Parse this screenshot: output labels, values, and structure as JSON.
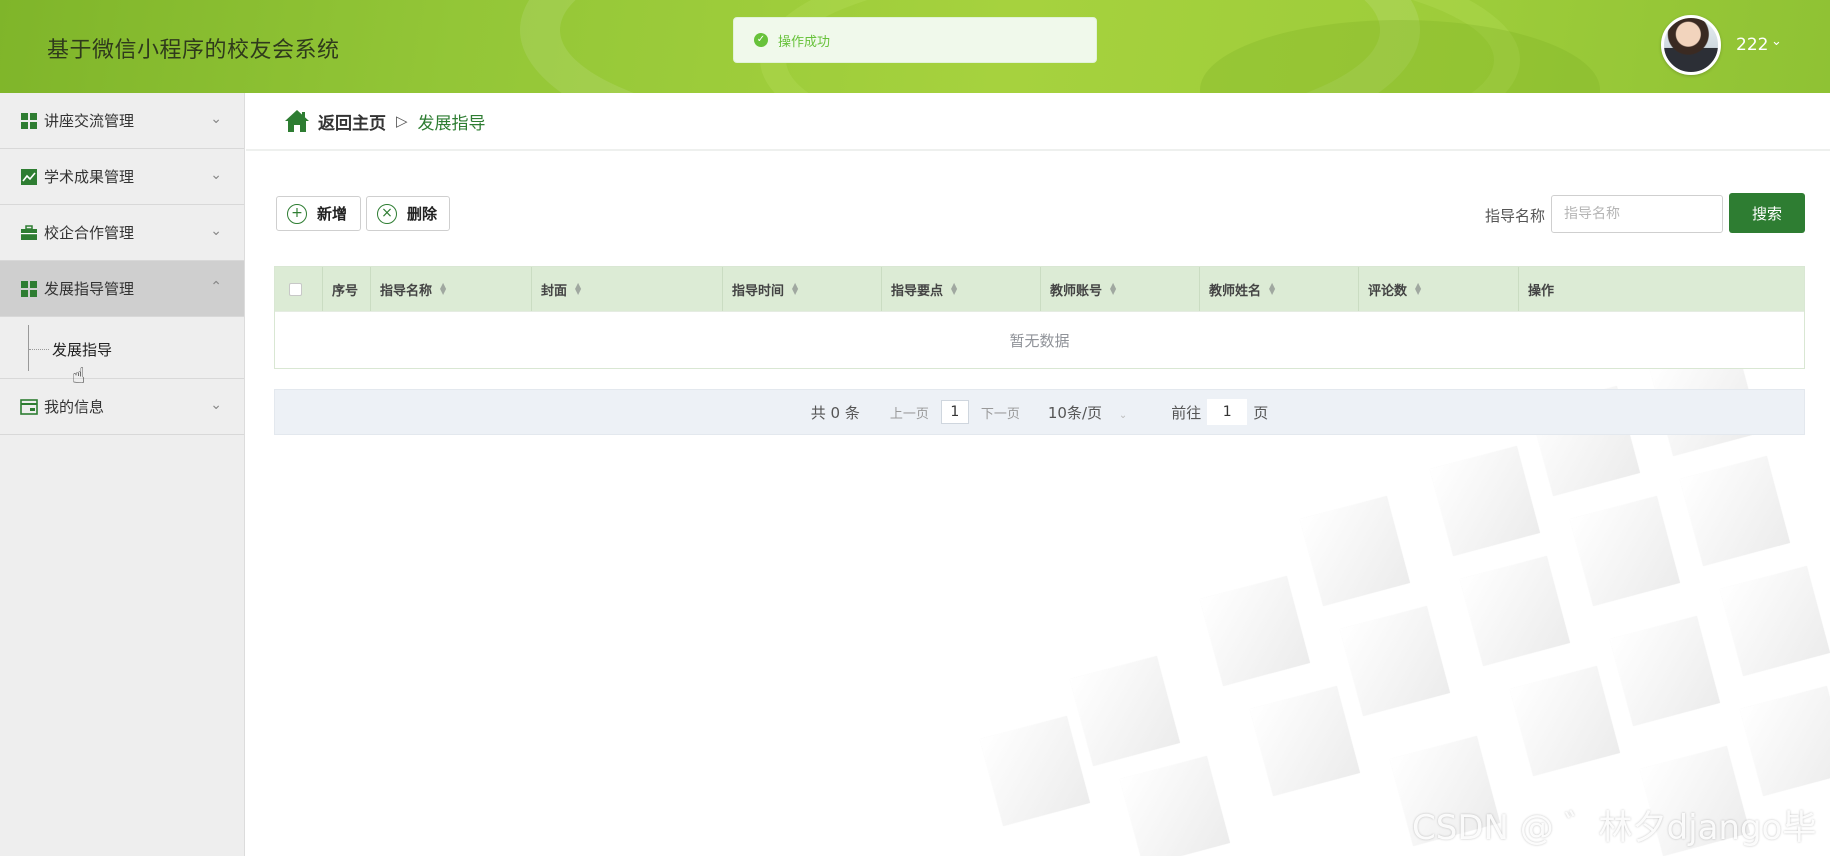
{
  "header": {
    "app_title": "基于微信小程序的校友会系统",
    "toast_text": "操作成功",
    "user_name": "222",
    "user_caret_icon": "chevron-down-icon"
  },
  "sidebar": {
    "items": [
      {
        "label": "讲座交流管理",
        "icon": "grid-icon",
        "expanded": false
      },
      {
        "label": "学术成果管理",
        "icon": "chart-icon",
        "expanded": false
      },
      {
        "label": "校企合作管理",
        "icon": "briefcase-icon",
        "expanded": false
      },
      {
        "label": "发展指导管理",
        "icon": "grid-icon",
        "expanded": true,
        "children": [
          {
            "label": "发展指导"
          }
        ]
      },
      {
        "label": "我的信息",
        "icon": "card-icon",
        "expanded": false
      }
    ]
  },
  "breadcrumb": {
    "home": "返回主页",
    "separator": "▷",
    "current": "发展指导"
  },
  "toolbar": {
    "add_label": "新增",
    "delete_label": "删除"
  },
  "search": {
    "label": "指导名称",
    "placeholder": "指导名称",
    "value": "",
    "button_label": "搜索"
  },
  "table": {
    "columns": [
      "序号",
      "指导名称",
      "封面",
      "指导时间",
      "指导要点",
      "教师账号",
      "教师姓名",
      "评论数",
      "操作"
    ],
    "empty_text": "暂无数据"
  },
  "pagination": {
    "total_text": "共 0 条",
    "prev": "上一页",
    "current_page": "1",
    "next": "下一页",
    "page_size": "10条/页",
    "goto_prefix": "前往",
    "goto_value": "1",
    "goto_suffix": "页"
  },
  "watermark": "CSDN @ ゛林夕django毕设",
  "colors": {
    "accent": "#2e7d32",
    "header_green": "#9dcc3a",
    "table_header": "#dcebd5",
    "success": "#67c23a"
  }
}
